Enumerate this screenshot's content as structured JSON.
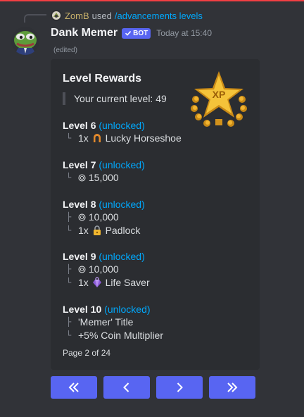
{
  "reply": {
    "username": "ZomB",
    "action": "used",
    "command": "/advancements levels"
  },
  "message": {
    "username": "Dank Memer",
    "bot_tag": "BOT",
    "timestamp": "Today at 15:40",
    "edited": "(edited)"
  },
  "embed": {
    "title": "Level Rewards",
    "current_level": "Your current level: 49",
    "thumbnail_label": "XP",
    "levels": [
      {
        "name": "Level 6",
        "status": "(unlocked)",
        "items": [
          "1x",
          "Lucky Horseshoe"
        ]
      },
      {
        "name": "Level 7",
        "status": "(unlocked)",
        "items": [
          "15,000"
        ]
      },
      {
        "name": "Level 8",
        "status": "(unlocked)",
        "items": [
          "10,000",
          "1x",
          "Padlock"
        ]
      },
      {
        "name": "Level 9",
        "status": "(unlocked)",
        "items": [
          "10,000",
          "1x",
          "Life Saver"
        ]
      },
      {
        "name": "Level 10",
        "status": "(unlocked)",
        "items": [
          "'Memer' Title",
          "+5% Coin Multiplier"
        ]
      }
    ],
    "footer": "Page 2 of 24"
  },
  "colors": {
    "accent": "#5865f2",
    "link": "#00a8fc",
    "embed_bg": "#2b2d31",
    "background": "#313338"
  },
  "icons": {
    "first_page": "double-chevron-left-icon",
    "prev_page": "chevron-left-icon",
    "next_page": "chevron-right-icon",
    "last_page": "double-chevron-right-icon"
  }
}
